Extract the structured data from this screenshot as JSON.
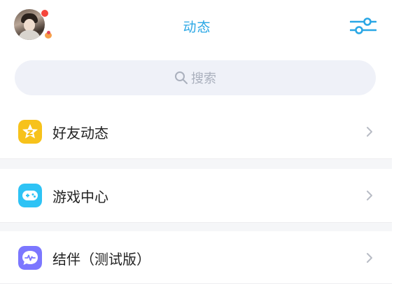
{
  "header": {
    "title": "动态"
  },
  "search": {
    "placeholder": "搜索"
  },
  "menu": [
    {
      "label": "好友动态",
      "icon": "friends-star-icon",
      "color": "#f7c21b"
    },
    {
      "label": "游戏中心",
      "icon": "gamepad-icon",
      "color": "#2ec3f5"
    },
    {
      "label": "结伴（测试版）",
      "icon": "chat-heartbeat-icon",
      "color": "#7c77ff"
    }
  ],
  "colors": {
    "accent": "#2aa7e5",
    "badge_red": "#f5453b"
  }
}
